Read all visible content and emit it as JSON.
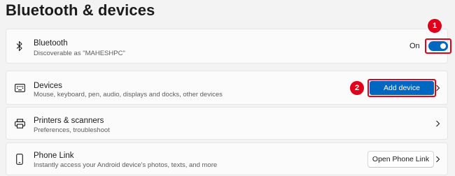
{
  "page": {
    "title": "Bluetooth & devices"
  },
  "bluetooth": {
    "icon": "bluetooth-icon",
    "title": "Bluetooth",
    "subtitle": "Discoverable as \"MAHESHPC\"",
    "toggle_state": "On",
    "toggle_on": true
  },
  "devices": {
    "icon": "keyboard-icon",
    "title": "Devices",
    "subtitle": "Mouse, keyboard, pen, audio, displays and docks, other devices",
    "button_label": "Add device"
  },
  "printers": {
    "icon": "printer-icon",
    "title": "Printers & scanners",
    "subtitle": "Preferences, troubleshoot"
  },
  "phone": {
    "icon": "phone-icon",
    "title": "Phone Link",
    "subtitle": "Instantly access your Android device's photos, texts, and more",
    "button_label": "Open Phone Link"
  },
  "callouts": {
    "one": "1",
    "two": "2"
  },
  "colors": {
    "accent": "#0067c0",
    "callout": "#e0001b"
  }
}
